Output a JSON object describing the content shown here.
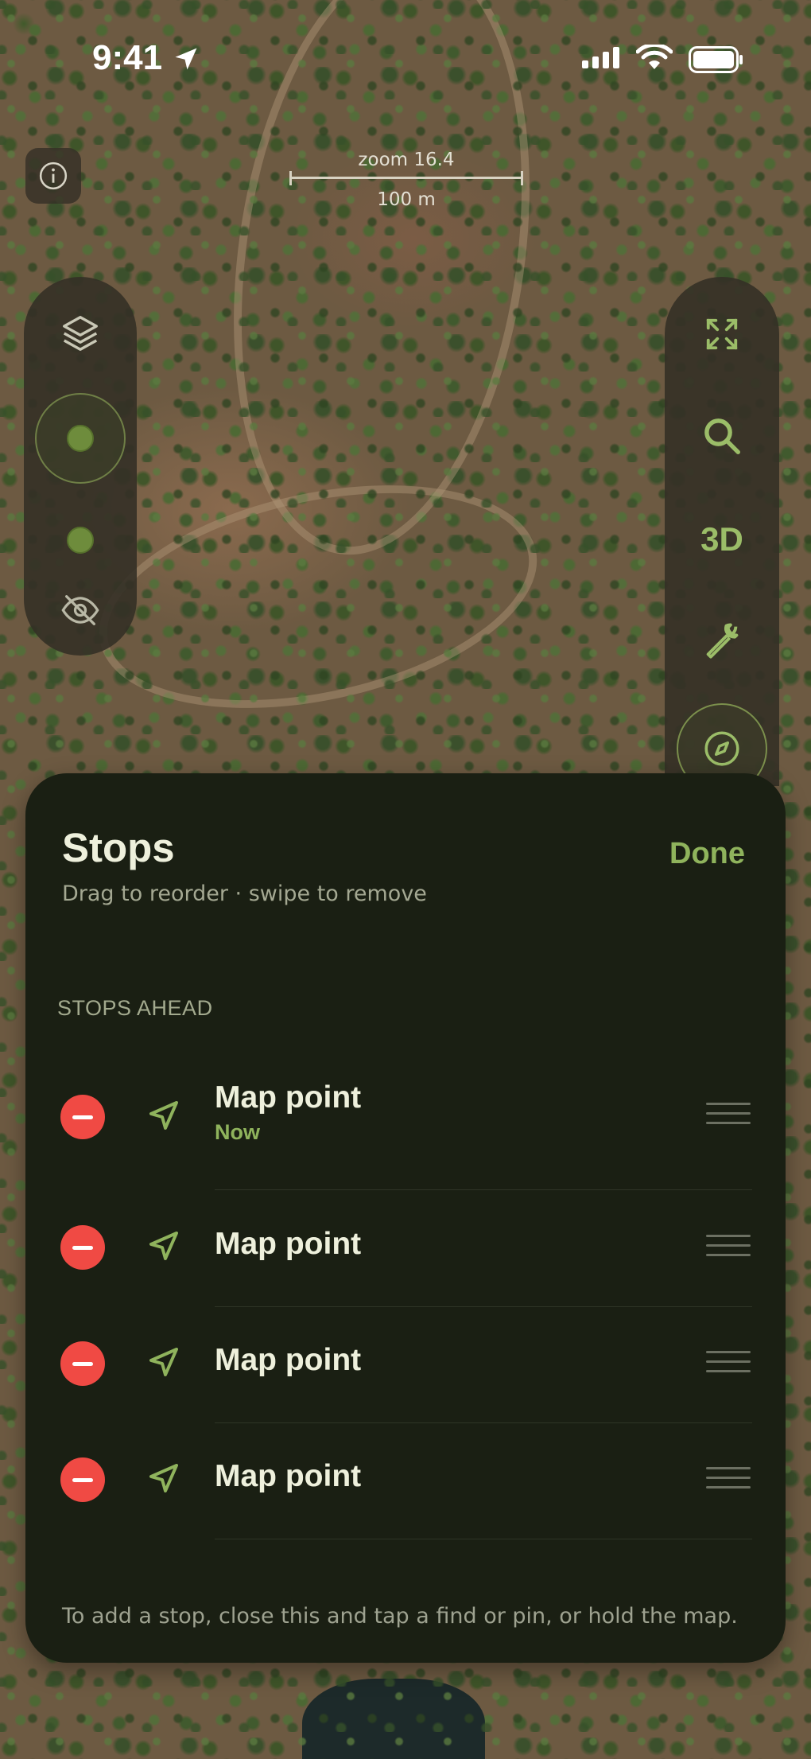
{
  "status_bar": {
    "time": "9:41",
    "icons": [
      "location-arrow-icon",
      "cellular-signal-icon",
      "wifi-icon",
      "battery-icon"
    ]
  },
  "map": {
    "zoom_label": "zoom 16.4",
    "scale_label": "100 m",
    "info_icon": "info-icon"
  },
  "left_controls": {
    "icons": [
      "layers-icon",
      "location-ring-icon",
      "dot-icon",
      "hide-icon"
    ]
  },
  "right_controls": {
    "icons": [
      "fullscreen-icon",
      "search-icon"
    ],
    "toggle_3d_label": "3D",
    "extra_icons": [
      "wrench-icon",
      "compass-icon"
    ]
  },
  "sheet": {
    "title": "Stops",
    "subtitle": "Drag to reorder · swipe to remove",
    "done_label": "Done",
    "section_label": "STOPS AHEAD",
    "stops": [
      {
        "name": "Map point",
        "time": "Now"
      },
      {
        "name": "Map point"
      },
      {
        "name": "Map point"
      },
      {
        "name": "Map point"
      }
    ],
    "footer": "To add a stop, close this and tap a find or pin, or hold the map."
  },
  "colors": {
    "accent": "#8fb35c",
    "sheet_bg": "#1a1f13",
    "remove": "#f04a44",
    "text_primary": "#eef0dc",
    "text_secondary": "#a4a892"
  }
}
